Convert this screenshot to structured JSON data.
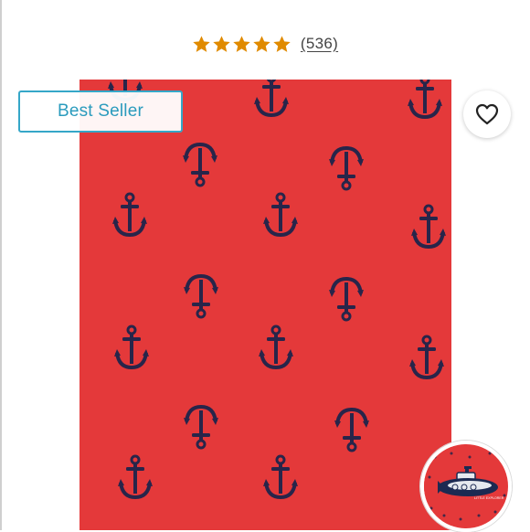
{
  "rating": {
    "stars_filled": 5,
    "stars_total": 5,
    "review_count": "(536)",
    "star_color": "#e08a00"
  },
  "badge": {
    "label": "Best Seller",
    "color": "#35a7c8"
  },
  "favorite": {
    "icon": "heart-outline-icon"
  },
  "product": {
    "fabric_color": "#e4393a",
    "print_color": "#28254a",
    "pattern": "anchor-print"
  },
  "swatch": {
    "label": "LITTLE EXPLORER",
    "icon": "submarine-icon"
  }
}
